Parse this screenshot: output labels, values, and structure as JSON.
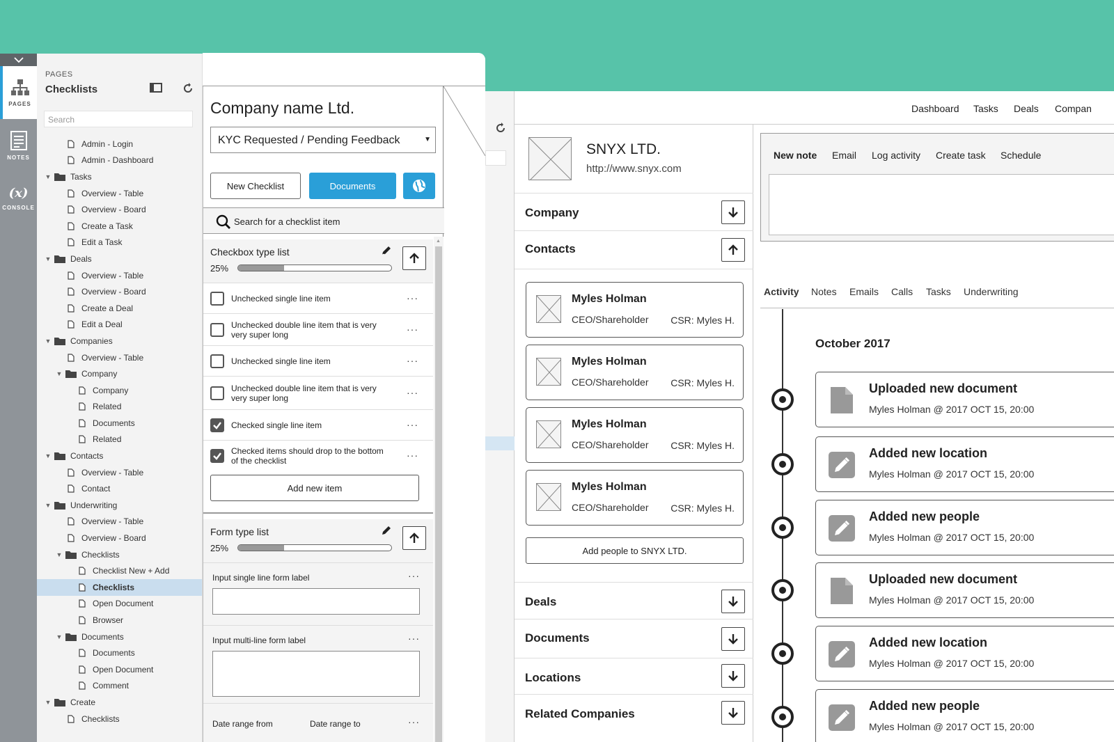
{
  "rail": {
    "items": [
      {
        "label": "PAGES",
        "icon": "sitemap-icon"
      },
      {
        "label": "NOTES",
        "icon": "notes-icon"
      },
      {
        "label": "CONSOLE",
        "icon": "variable-icon",
        "glyph": "(x)"
      }
    ]
  },
  "pages": {
    "header_small": "PAGES",
    "header_title": "Checklists",
    "search_placeholder": "Search",
    "tree": [
      {
        "label": "Admin - Login",
        "depth": 1,
        "type": "page"
      },
      {
        "label": "Admin - Dashboard",
        "depth": 1,
        "type": "page"
      },
      {
        "label": "Tasks",
        "depth": 0,
        "type": "folder"
      },
      {
        "label": "Overview - Table",
        "depth": 2,
        "type": "page"
      },
      {
        "label": "Overview - Board",
        "depth": 2,
        "type": "page"
      },
      {
        "label": "Create a Task",
        "depth": 2,
        "type": "page"
      },
      {
        "label": "Edit a Task",
        "depth": 2,
        "type": "page"
      },
      {
        "label": "Deals",
        "depth": 0,
        "type": "folder"
      },
      {
        "label": "Overview - Table",
        "depth": 2,
        "type": "page"
      },
      {
        "label": "Overview - Board",
        "depth": 2,
        "type": "page"
      },
      {
        "label": "Create a Deal",
        "depth": 2,
        "type": "page"
      },
      {
        "label": "Edit a Deal",
        "depth": 2,
        "type": "page"
      },
      {
        "label": "Companies",
        "depth": 0,
        "type": "folder"
      },
      {
        "label": "Overview - Table",
        "depth": 2,
        "type": "page"
      },
      {
        "label": "Company",
        "depth": 1,
        "type": "folder"
      },
      {
        "label": "Company",
        "depth": 3,
        "type": "page"
      },
      {
        "label": "Related",
        "depth": 3,
        "type": "page"
      },
      {
        "label": "Documents",
        "depth": 3,
        "type": "page"
      },
      {
        "label": "Related",
        "depth": 3,
        "type": "page"
      },
      {
        "label": "Contacts",
        "depth": 0,
        "type": "folder"
      },
      {
        "label": "Overview - Table",
        "depth": 2,
        "type": "page"
      },
      {
        "label": "Contact",
        "depth": 2,
        "type": "page"
      },
      {
        "label": "Underwriting",
        "depth": 0,
        "type": "folder"
      },
      {
        "label": "Overview - Table",
        "depth": 2,
        "type": "page"
      },
      {
        "label": "Overview - Board",
        "depth": 2,
        "type": "page"
      },
      {
        "label": "Checklists",
        "depth": 1,
        "type": "folder"
      },
      {
        "label": "Checklist New + Add",
        "depth": 3,
        "type": "page"
      },
      {
        "label": "Checklists",
        "depth": 3,
        "type": "page",
        "selected": true
      },
      {
        "label": "Open Document",
        "depth": 3,
        "type": "page"
      },
      {
        "label": "Browser",
        "depth": 3,
        "type": "page"
      },
      {
        "label": "Documents",
        "depth": 1,
        "type": "folder"
      },
      {
        "label": "Documents",
        "depth": 3,
        "type": "page"
      },
      {
        "label": "Open Document",
        "depth": 3,
        "type": "page"
      },
      {
        "label": "Comment",
        "depth": 3,
        "type": "page"
      },
      {
        "label": "Create",
        "depth": 0,
        "type": "folder"
      },
      {
        "label": "Checklists",
        "depth": 2,
        "type": "page"
      }
    ]
  },
  "checklist": {
    "company_title": "Company name Ltd.",
    "status_value": "KYC Requested / Pending Feedback",
    "new_checklist_label": "New Checklist",
    "documents_label": "Documents",
    "search_label": "Search for a checklist item",
    "list1": {
      "title": "Checkbox type list",
      "progress_text": "25%",
      "progress": 0.3,
      "items": [
        {
          "text": "Unchecked single line item",
          "checked": false
        },
        {
          "text": "Unchecked double line item that is very very super long",
          "checked": false
        },
        {
          "text": "Unchecked single line item",
          "checked": false
        },
        {
          "text": "Unchecked double line item that is very very super long",
          "checked": false
        },
        {
          "text": "Checked single line item",
          "checked": true
        },
        {
          "text": "Checked items should drop to the bottom of the checklist",
          "checked": true
        }
      ],
      "add_label": "Add new item"
    },
    "list2": {
      "title": "Form type list",
      "progress_text": "25%",
      "progress": 0.3,
      "fields": {
        "single_label": "Input single line form label",
        "multi_label": "Input multi-line form label",
        "date_from_label": "Date range from",
        "date_to_label": "Date range to"
      }
    },
    "more_glyph": "···",
    "colors": {
      "primary": "#2a9fd8"
    }
  },
  "crm": {
    "nav": [
      "Dashboard",
      "Tasks",
      "Deals",
      "Compan"
    ],
    "company_name": "SNYX LTD.",
    "company_url": "http://www.snyx.com",
    "sections": {
      "company": "Company",
      "contacts": "Contacts",
      "deals": "Deals",
      "documents": "Documents",
      "locations": "Locations",
      "related": "Related Companies"
    },
    "contacts": [
      {
        "name": "Myles Holman",
        "role": "CEO/Shareholder",
        "csr": "CSR: Myles H."
      },
      {
        "name": "Myles Holman",
        "role": "CEO/Shareholder",
        "csr": "CSR: Myles H."
      },
      {
        "name": "Myles Holman",
        "role": "CEO/Shareholder",
        "csr": "CSR: Myles H."
      },
      {
        "name": "Myles Holman",
        "role": "CEO/Shareholder",
        "csr": "CSR: Myles H."
      }
    ],
    "add_people_label": "Add people to SNYX LTD.",
    "note_tabs": [
      "New note",
      "Email",
      "Log activity",
      "Create task",
      "Schedule"
    ],
    "activity_tabs": [
      "Activity",
      "Notes",
      "Emails",
      "Calls",
      "Tasks",
      "Underwriting"
    ],
    "month": "October 2017",
    "events": [
      {
        "title": "Uploaded new document",
        "meta": "Myles Holman @ 2017 OCT 15, 20:00",
        "icon": "document-icon"
      },
      {
        "title": "Added new location",
        "meta": "Myles Holman @ 2017 OCT 15, 20:00",
        "icon": "pencil-icon"
      },
      {
        "title": "Added new people",
        "meta": "Myles Holman @ 2017 OCT 15, 20:00",
        "icon": "pencil-icon"
      },
      {
        "title": "Uploaded new document",
        "meta": "Myles Holman @ 2017 OCT 15, 20:00",
        "icon": "document-icon"
      },
      {
        "title": "Added new location",
        "meta": "Myles Holman @ 2017 OCT 15, 20:00",
        "icon": "pencil-icon"
      },
      {
        "title": "Added new people",
        "meta": "Myles Holman @ 2017 OCT 15, 20:00",
        "icon": "pencil-icon"
      }
    ]
  }
}
